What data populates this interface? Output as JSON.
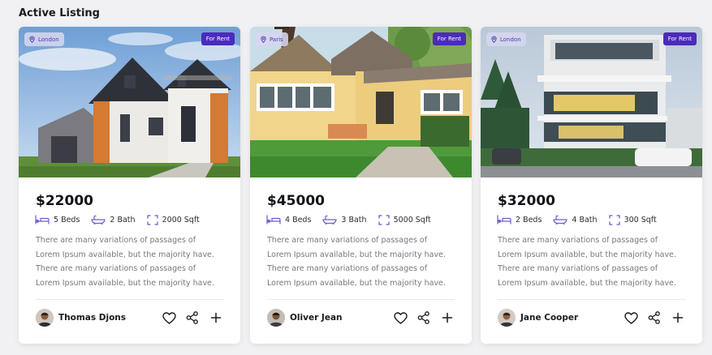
{
  "section_title": "Active Listing",
  "colors": {
    "accent": "#4b2bbd",
    "icon": "#6c5dd3",
    "price": "#121218",
    "text_muted": "#77777f"
  },
  "listings": [
    {
      "location": "London",
      "badge": "For Rent",
      "price": "$22000",
      "beds": "5 Beds",
      "baths": "2 Bath",
      "area": "2000 Sqft",
      "description": [
        "There are many variations of passages of",
        "Lorem Ipsum available, but the majority have.",
        "There are many variations of passages of",
        "Lorem Ipsum available, but the majority have."
      ],
      "agent": "Thomas Djons"
    },
    {
      "location": "Paris",
      "badge": "For Rent",
      "price": "$45000",
      "beds": "4 Beds",
      "baths": "3 Bath",
      "area": "5000 Sqft",
      "description": [
        "There are many variations of passages of",
        "Lorem Ipsum available, but the majority have.",
        "There are many variations of passages of",
        "Lorem Ipsum available, but the majority have."
      ],
      "agent": "Oliver Jean"
    },
    {
      "location": "London",
      "badge": "For Rent",
      "price": "$32000",
      "beds": "2 Beds",
      "baths": "4 Bath",
      "area": "300 Sqft",
      "description": [
        "There are many variations of passages of",
        "Lorem Ipsum available, but the majority have.",
        "There are many variations of passages of",
        "Lorem Ipsum available, but the majority have."
      ],
      "agent": "Jane Cooper"
    }
  ],
  "icons": {
    "location": "map-pin-icon",
    "beds": "bed-icon",
    "baths": "bathtub-icon",
    "area": "area-frame-icon",
    "favorite": "heart-icon",
    "share": "share-icon",
    "add": "plus-icon"
  }
}
